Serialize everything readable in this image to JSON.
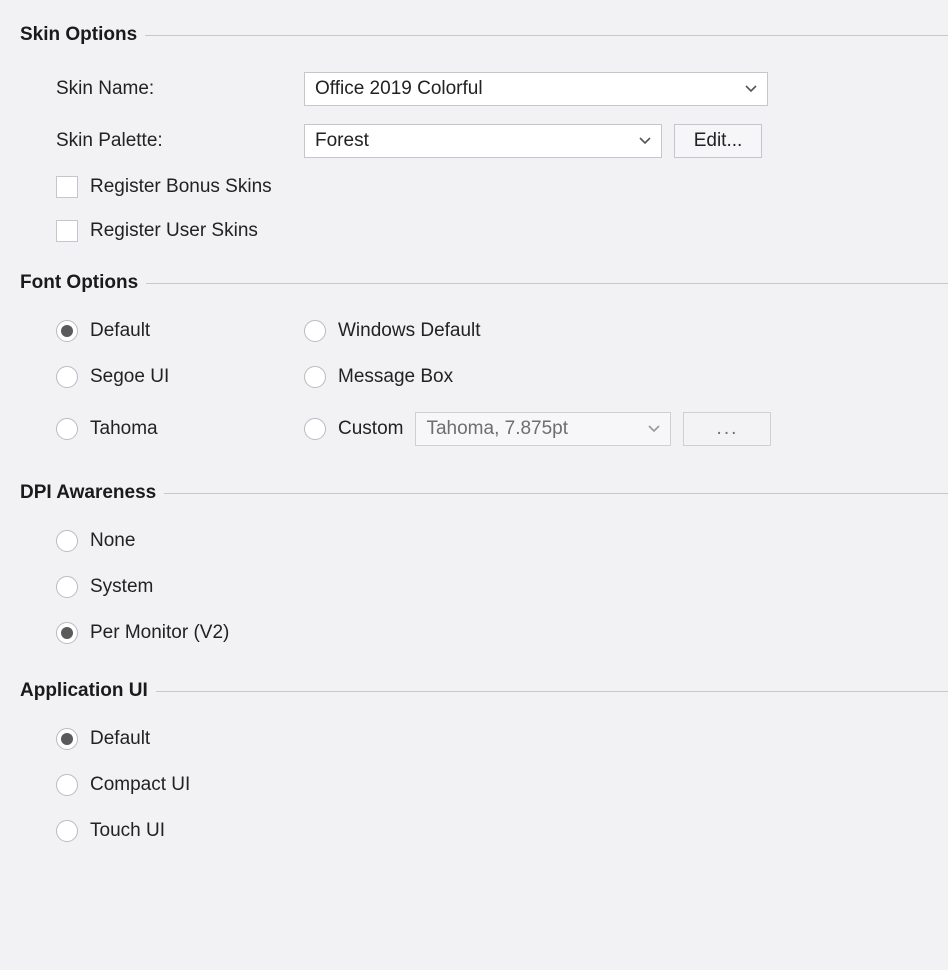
{
  "skin_options": {
    "title": "Skin Options",
    "skin_name": {
      "label": "Skin Name:",
      "value": "Office 2019 Colorful"
    },
    "skin_palette": {
      "label": "Skin Palette:",
      "value": "Forest",
      "edit_label": "Edit..."
    },
    "register_bonus": {
      "label": "Register Bonus Skins"
    },
    "register_user": {
      "label": "Register User Skins"
    }
  },
  "font_options": {
    "title": "Font Options",
    "radios": {
      "default": "Default",
      "windows_default": "Windows Default",
      "segoe": "Segoe UI",
      "message_box": "Message Box",
      "tahoma": "Tahoma",
      "custom": "Custom"
    },
    "custom_font_value": "Tahoma, 7.875pt",
    "ellipsis": "..."
  },
  "dpi": {
    "title": "DPI Awareness",
    "radios": {
      "none": "None",
      "system": "System",
      "per_monitor": "Per Monitor (V2)"
    }
  },
  "app_ui": {
    "title": "Application UI",
    "radios": {
      "default": "Default",
      "compact": "Compact UI",
      "touch": "Touch UI"
    }
  }
}
